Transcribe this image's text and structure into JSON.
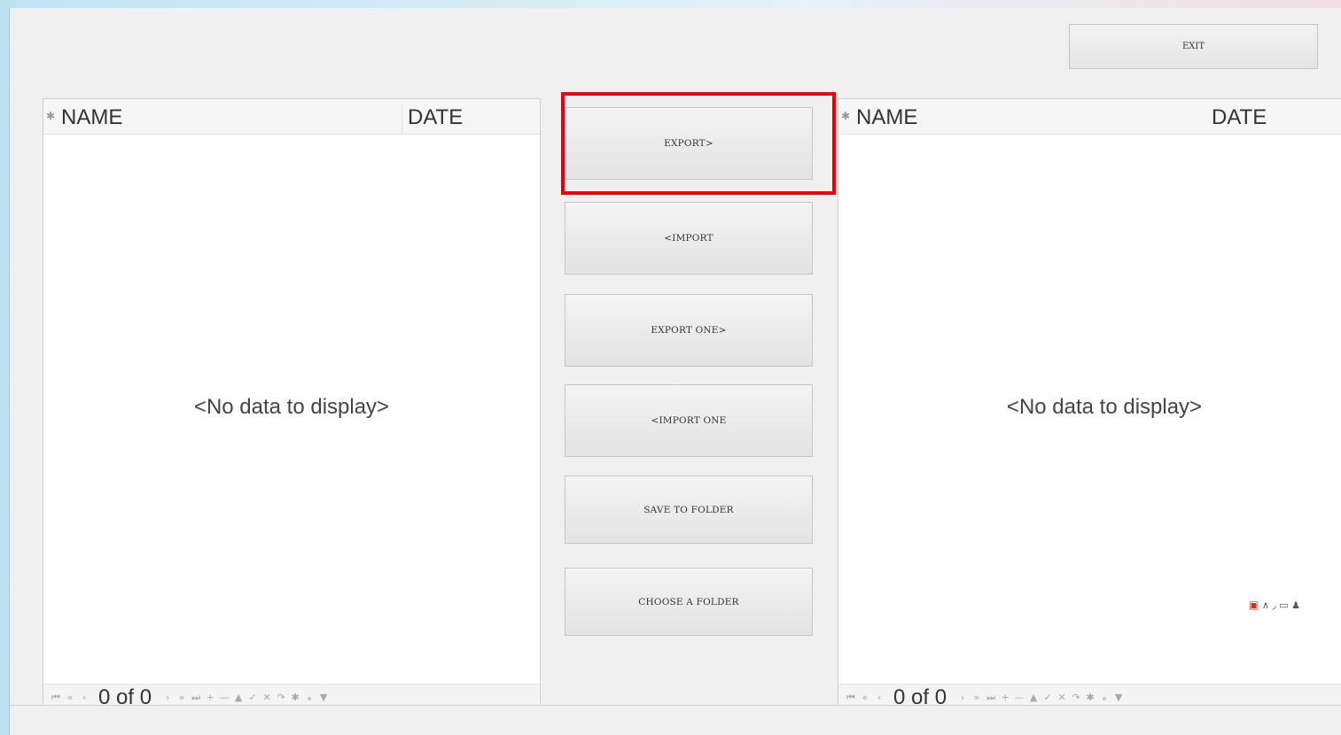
{
  "toolbar": {
    "exit_label": "EXIT"
  },
  "left_grid": {
    "columns": [
      "NAME",
      "DATE"
    ],
    "empty_text": "<No data to display>",
    "pager": "0 of 0"
  },
  "right_grid": {
    "columns": [
      "NAME",
      "DATE"
    ],
    "empty_text": "<No data to display>",
    "pager": "0 of 0"
  },
  "actions": {
    "export": "EXPORT>",
    "import": "<IMPORT",
    "export_one": "EXPORT ONE>",
    "import_one": "<IMPORT ONE",
    "save_to_folder": "SAVE TO FOLDER",
    "choose_folder": "CHOOSE A FOLDER"
  },
  "nav_icons": [
    "first",
    "prev-page",
    "prev",
    "next",
    "next-page",
    "last",
    "append",
    "delete",
    "edit",
    "end-edit",
    "cancel-edit",
    "refresh",
    "filter-star",
    "clear-filter",
    "filter"
  ],
  "highlight_color": "#e8000b"
}
